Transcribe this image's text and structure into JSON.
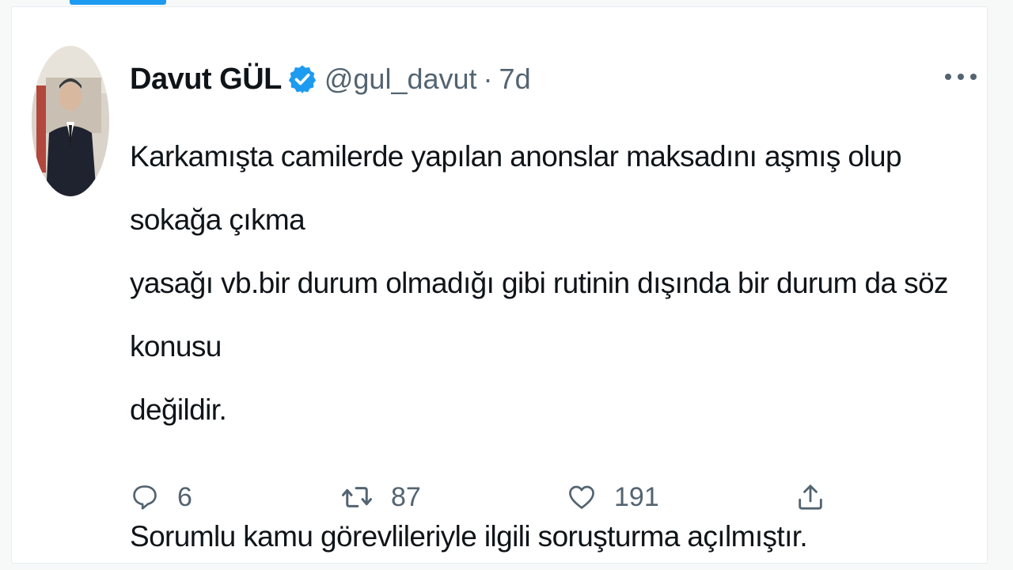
{
  "tweet": {
    "author_name": "Davut GÜL",
    "handle": "@gul_davut",
    "separator": "·",
    "time": "7d",
    "verified_icon": "verified-badge-icon",
    "more_icon": "more-horizontal-icon",
    "text_lines": [
      "Karkamışta camilerde yapılan anonslar maksadını aşmış olup sokağa çıkma",
      "yasağı vb.bir durum olmadığı gibi rutinin dışında bir durum da söz konusu",
      "değildir."
    ],
    "text_second_paragraph": "Sorumlu kamu görevlileriyle ilgili soruşturma açılmıştır."
  },
  "actions": {
    "reply": {
      "icon": "reply-icon",
      "count": "6"
    },
    "retweet": {
      "icon": "retweet-icon",
      "count": "87"
    },
    "like": {
      "icon": "heart-icon",
      "count": "191"
    },
    "share": {
      "icon": "share-icon"
    }
  },
  "colors": {
    "accent": "#1d9bf0",
    "text": "#0f1419",
    "secondary": "#536471"
  }
}
